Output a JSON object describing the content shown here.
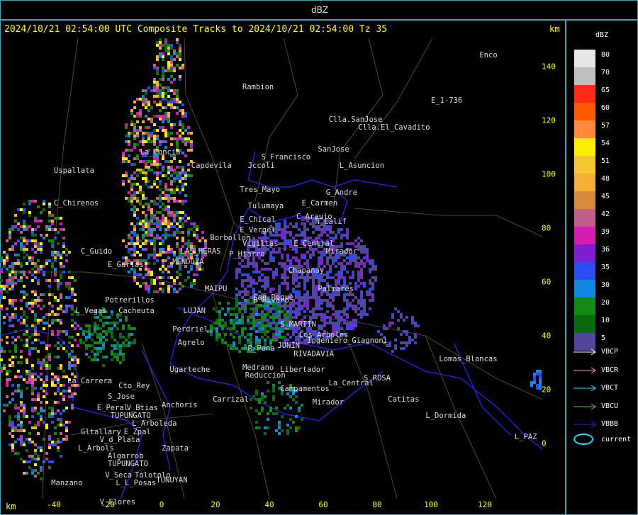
{
  "topbar": {
    "title": "dBZ"
  },
  "header": {
    "text": "2024/10/21 02:54:00 UTC Composite Tracks to 2024/10/21 02:54:00 Tz 35",
    "km_top": "km",
    "km_bottom": "km"
  },
  "axes": {
    "x_ticks": [
      "-40",
      "-20",
      "0",
      "20",
      "40",
      "60",
      "80",
      "100",
      "120"
    ],
    "x_values": [
      -40,
      -20,
      0,
      20,
      40,
      60,
      80,
      100,
      120
    ],
    "y_ticks": [
      "140",
      "120",
      "100",
      "80",
      "60",
      "40",
      "20",
      "0"
    ],
    "y_values": [
      140,
      120,
      100,
      80,
      60,
      40,
      20,
      0
    ]
  },
  "places": [
    {
      "name": "Rambion",
      "x": 30,
      "y": 132
    },
    {
      "name": "Enco",
      "x": 118,
      "y": 144
    },
    {
      "name": "E_1-736",
      "x": 100,
      "y": 127
    },
    {
      "name": "Clla.SanJose",
      "x": 62,
      "y": 120
    },
    {
      "name": "Clla.El_Cavadito",
      "x": 73,
      "y": 117
    },
    {
      "name": "S_Francisco",
      "x": 37,
      "y": 106
    },
    {
      "name": "SanJose",
      "x": 58,
      "y": 109
    },
    {
      "name": "Jccoli",
      "x": 32,
      "y": 103
    },
    {
      "name": "L_Asuncion",
      "x": 66,
      "y": 103
    },
    {
      "name": "Uspallata",
      "x": -40,
      "y": 101
    },
    {
      "name": "C_Chirenos",
      "x": -40,
      "y": 89
    },
    {
      "name": "Tres_Mayo",
      "x": 29,
      "y": 94
    },
    {
      "name": "G_Andre",
      "x": 61,
      "y": 93
    },
    {
      "name": "Tulumaya",
      "x": 32,
      "y": 88
    },
    {
      "name": "E_Carmen",
      "x": 52,
      "y": 89
    },
    {
      "name": "E_Chical",
      "x": 29,
      "y": 83
    },
    {
      "name": "C_Araujo",
      "x": 50,
      "y": 84
    },
    {
      "name": "N_Calif",
      "x": 57,
      "y": 82
    },
    {
      "name": "E_Vergel",
      "x": 29,
      "y": 79
    },
    {
      "name": "Borbollon",
      "x": 18,
      "y": 76
    },
    {
      "name": "Vigiltas",
      "x": 30,
      "y": 74
    },
    {
      "name": "E_Central",
      "x": 49,
      "y": 74
    },
    {
      "name": "Mirador",
      "x": 61,
      "y": 71
    },
    {
      "name": "P_Hiarro",
      "x": 25,
      "y": 70
    },
    {
      "name": "C_Guido",
      "x": -30,
      "y": 71
    },
    {
      "name": "E_Garlas",
      "x": -20,
      "y": 66
    },
    {
      "name": "Potrerillos",
      "x": -21,
      "y": 53
    },
    {
      "name": "L_Vegas",
      "x": -32,
      "y": 49
    },
    {
      "name": "Cacheuta",
      "x": -16,
      "y": 49
    },
    {
      "name": "Perdriel",
      "x": 4,
      "y": 42
    },
    {
      "name": "Agrelo",
      "x": 6,
      "y": 37
    },
    {
      "name": "R_Pena",
      "x": 32,
      "y": 35
    },
    {
      "name": "Medrano",
      "x": 30,
      "y": 28
    },
    {
      "name": "Reduccion",
      "x": 31,
      "y": 25
    },
    {
      "name": "Lomas_Blancas",
      "x": 103,
      "y": 31
    },
    {
      "name": "S_ROSA",
      "x": 75,
      "y": 24
    },
    {
      "name": "Campamentos",
      "x": 44,
      "y": 20
    },
    {
      "name": "Ugarteche",
      "x": 3,
      "y": 27
    },
    {
      "name": "La_Carrera",
      "x": -35,
      "y": 23
    },
    {
      "name": "Cto_Rey",
      "x": -16,
      "y": 21
    },
    {
      "name": "S_Jose",
      "x": -20,
      "y": 17
    },
    {
      "name": "Carrizal",
      "x": 19,
      "y": 16
    },
    {
      "name": "Mirador",
      "x": 56,
      "y": 15
    },
    {
      "name": "Catitas",
      "x": 84,
      "y": 16
    },
    {
      "name": "Anchoris",
      "x": 0,
      "y": 14
    },
    {
      "name": "E_Peral",
      "x": -24,
      "y": 13
    },
    {
      "name": "V_Btias",
      "x": -13,
      "y": 13
    },
    {
      "name": "TUPUNGATO",
      "x": -19,
      "y": 10
    },
    {
      "name": "L_Dormida",
      "x": 98,
      "y": 10
    },
    {
      "name": "L_Arboleda",
      "x": -11,
      "y": 7
    },
    {
      "name": "Gltallary",
      "x": -30,
      "y": 4
    },
    {
      "name": "E_Zpal",
      "x": -14,
      "y": 4
    },
    {
      "name": "V_d_Plata",
      "x": -23,
      "y": 1
    },
    {
      "name": "L_PAZ",
      "x": 131,
      "y": 2
    },
    {
      "name": "L_Arbols",
      "x": -31,
      "y": -2
    },
    {
      "name": "Zapata",
      "x": 0,
      "y": -2
    },
    {
      "name": "Algarrob",
      "x": -20,
      "y": -5
    },
    {
      "name": "TUPUNGATO",
      "x": -20,
      "y": -8
    },
    {
      "name": "V_Seca",
      "x": -21,
      "y": -12
    },
    {
      "name": "Tolotolo",
      "x": -10,
      "y": -12
    },
    {
      "name": "Manzano",
      "x": -41,
      "y": -15
    },
    {
      "name": "L_L_Posas",
      "x": -17,
      "y": -15
    },
    {
      "name": "TUNUYAN",
      "x": -2,
      "y": -14
    },
    {
      "name": "V_Flores",
      "x": -23,
      "y": -22
    },
    {
      "name": "La_Concia",
      "x": -8,
      "y": 108
    },
    {
      "name": "Capdevila",
      "x": 11,
      "y": 103
    },
    {
      "name": "LAS_HERAS",
      "x": 7,
      "y": 71
    },
    {
      "name": "MENDOZA",
      "x": 4,
      "y": 67
    },
    {
      "name": "MAIPU",
      "x": 16,
      "y": 57
    },
    {
      "name": "LUJAN",
      "x": 8,
      "y": 49
    },
    {
      "name": "JUNIN",
      "x": 43,
      "y": 36
    },
    {
      "name": "RIVADAVIA",
      "x": 49,
      "y": 33
    },
    {
      "name": "S_MARTIN",
      "x": 44,
      "y": 44
    },
    {
      "name": "Chapanay",
      "x": 47,
      "y": 64
    },
    {
      "name": "Libertador",
      "x": 44,
      "y": 27
    },
    {
      "name": "Palmares",
      "x": 58,
      "y": 57
    },
    {
      "name": "San_Roque",
      "x": 34,
      "y": 54
    },
    {
      "name": "Ingeniero_Giagnoni",
      "x": 54,
      "y": 38
    },
    {
      "name": "Los_Arboles",
      "x": 51,
      "y": 40
    },
    {
      "name": "La_Central",
      "x": 62,
      "y": 22
    },
    {
      "name": "B_Rivero",
      "x": 34,
      "y": 53
    }
  ],
  "legend": {
    "title": "dBZ",
    "levels": [
      {
        "label": "80",
        "color": "#e6e6e6"
      },
      {
        "label": "70",
        "color": "#bfbfbf"
      },
      {
        "label": "65",
        "color": "#ff2a1a"
      },
      {
        "label": "60",
        "color": "#ff5a00"
      },
      {
        "label": "57",
        "color": "#ff8a3a"
      },
      {
        "label": "54",
        "color": "#ffee00"
      },
      {
        "label": "51",
        "color": "#f7c531"
      },
      {
        "label": "48",
        "color": "#f2b135"
      },
      {
        "label": "45",
        "color": "#d88a3c"
      },
      {
        "label": "42",
        "color": "#c05f8a"
      },
      {
        "label": "39",
        "color": "#d11eb0"
      },
      {
        "label": "36",
        "color": "#7e1ed0"
      },
      {
        "label": "35",
        "color": "#2a4cf0"
      },
      {
        "label": "30",
        "color": "#0f88e0"
      },
      {
        "label": "20",
        "color": "#128a14"
      },
      {
        "label": "10",
        "color": "#0b6a0e"
      },
      {
        "label": "5",
        "color": "#52459a"
      }
    ],
    "tracks": [
      {
        "label": "VBCP",
        "color": "#ffffff"
      },
      {
        "label": "VBCR",
        "color": "#ff9f80"
      },
      {
        "label": "VBCT",
        "color": "#00e5ff"
      },
      {
        "label": "VBCU",
        "color": "#33cc33"
      },
      {
        "label": "VBBB",
        "color": "#2020ff"
      }
    ],
    "current_label": "current"
  }
}
